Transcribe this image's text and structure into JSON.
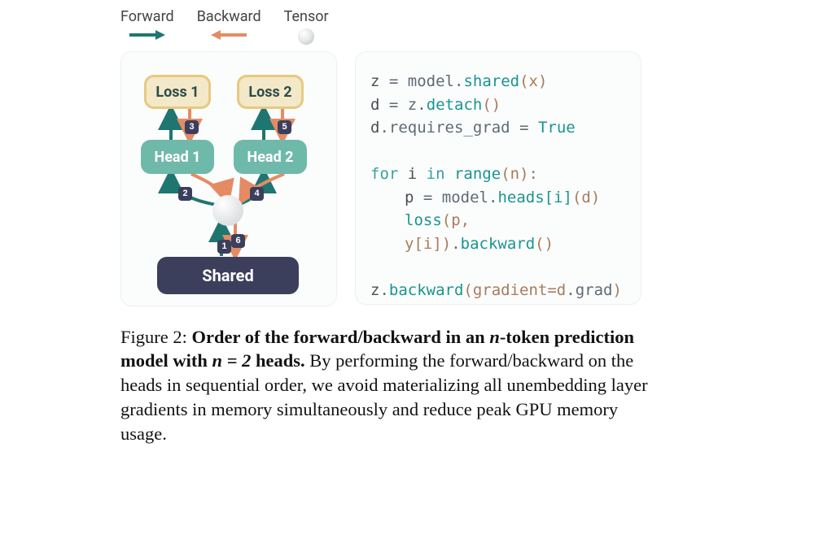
{
  "legend": {
    "forward": "Forward",
    "backward": "Backward",
    "tensor": "Tensor"
  },
  "diagram": {
    "loss1": "Loss 1",
    "loss2": "Loss 2",
    "head1": "Head 1",
    "head2": "Head 2",
    "shared": "Shared",
    "steps": {
      "s1": "1",
      "s2": "2",
      "s3": "3",
      "s4": "4",
      "s5": "5",
      "s6": "6"
    }
  },
  "code": {
    "l1a": "z ",
    "l1b": "=",
    "l1c": " model",
    "l1d": ".",
    "l1e": "shared",
    "l1f": "(x)",
    "l2a": "d ",
    "l2b": "=",
    "l2c": " z",
    "l2d": ".",
    "l2e": "detach",
    "l2f": "()",
    "l3a": "d",
    "l3b": ".",
    "l3c": "requires_grad ",
    "l3d": "=",
    "l3e": " True",
    "l4a": "for",
    "l4b": " i ",
    "l4c": "in",
    "l4d": " range",
    "l4e": "(n):",
    "l5a": "p ",
    "l5b": "=",
    "l5c": " model",
    "l5d": ".",
    "l5e": "heads[i]",
    "l5f": "(d)",
    "l6a": "loss",
    "l6b": "(p, y[i])",
    "l6c": ".",
    "l6d": "backward",
    "l6e": "()",
    "l7a": "z",
    "l7b": ".",
    "l7c": "backward",
    "l7d": "(gradient=d",
    "l7e": ".",
    "l7f": "grad",
    "l7g": ")"
  },
  "caption": {
    "lead": "Figure 2: ",
    "bold1": "Order of the forward/backward in an ",
    "boldN": "n",
    "bold2": "-token prediction model with ",
    "boldEq": "n = 2",
    "bold3": " heads.",
    "rest": " By performing the forward/backward on the heads in sequential order, we avoid materializing all unembedding layer gradients in memory simultaneously and reduce peak GPU memory usage."
  }
}
